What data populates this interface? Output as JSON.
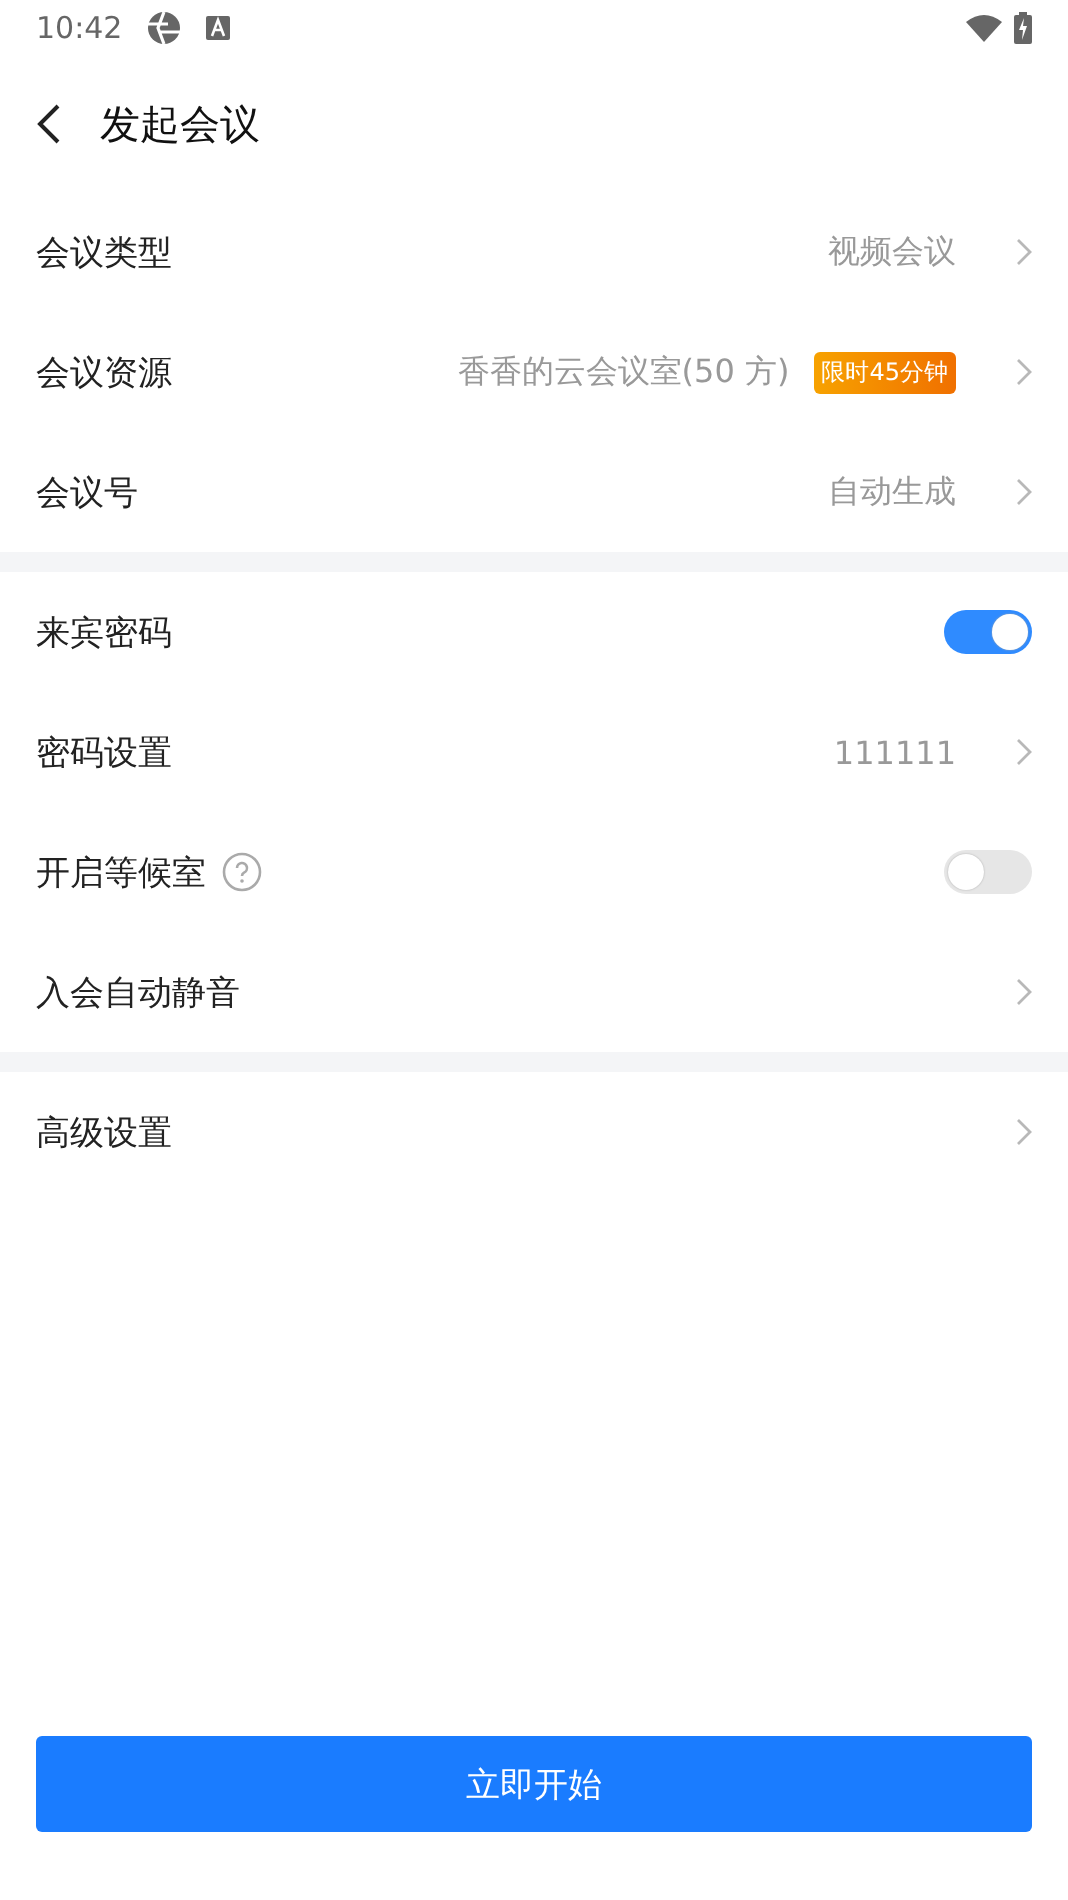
{
  "status_bar": {
    "time": "10:42"
  },
  "header": {
    "title": "发起会议"
  },
  "groups": [
    {
      "rows": [
        {
          "kind": "value",
          "label": "会议类型",
          "value": "视频会议"
        },
        {
          "kind": "value",
          "label": "会议资源",
          "value": "香香的云会议室(50 方)",
          "badge": "限时45分钟"
        },
        {
          "kind": "value",
          "label": "会议号",
          "value": "自动生成"
        }
      ]
    },
    {
      "rows": [
        {
          "kind": "toggle",
          "label": "来宾密码",
          "on": true
        },
        {
          "kind": "value",
          "label": "密码设置",
          "value": "111111"
        },
        {
          "kind": "toggle",
          "label": "开启等候室",
          "on": false,
          "help": true
        },
        {
          "kind": "value",
          "label": "入会自动静音"
        }
      ]
    },
    {
      "rows": [
        {
          "kind": "value",
          "label": "高级设置"
        }
      ]
    }
  ],
  "start_button": "立即开始"
}
